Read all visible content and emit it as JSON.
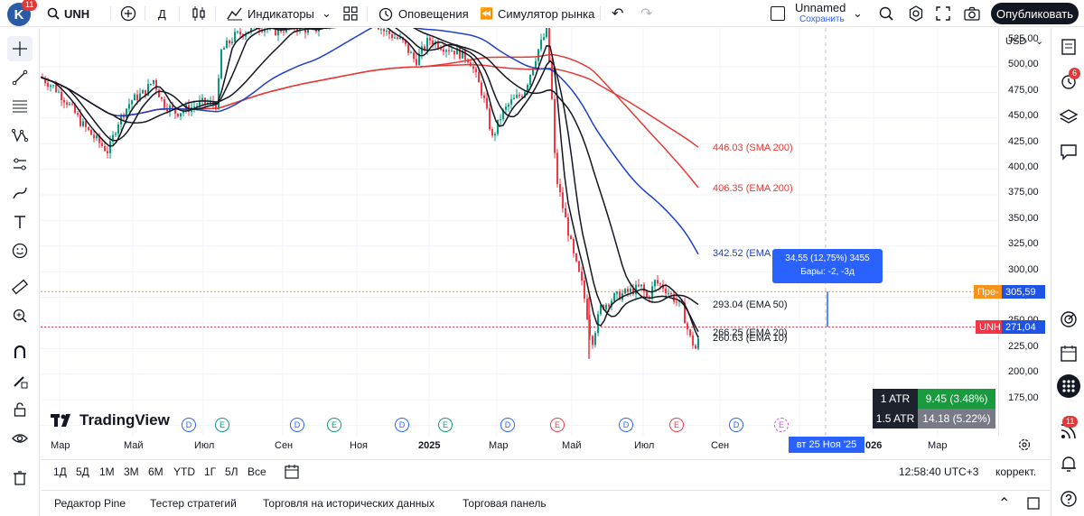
{
  "top": {
    "avatar_letter": "K",
    "avatar_badge": "11",
    "symbol": "UNH",
    "interval": "Д",
    "indicators_label": "Индикаторы",
    "alerts_label": "Оповещения",
    "replay_label": "Симулятор рынка",
    "layout_name": "Unnamed",
    "save_label": "Сохранить",
    "publish_label": "Опубликовать"
  },
  "price_scale": {
    "currency": "USD",
    "ticks": [
      "525,00",
      "500,00",
      "475,00",
      "450,00",
      "425,00",
      "400,00",
      "375,00",
      "350,00",
      "325,00",
      "300,00",
      "275,00",
      "250,00",
      "225,00",
      "200,00",
      "175,00"
    ],
    "pre_label": "Пре-",
    "pre_price": "305,59",
    "symbol_label": "UNH",
    "last_price": "271,04"
  },
  "time_axis": {
    "labels": [
      "Мар",
      "Май",
      "Июл",
      "Сен",
      "Ноя",
      "2025",
      "Мар",
      "Май",
      "Июл",
      "Сен",
      "026",
      "Мар"
    ],
    "crosshair_date": "вт 25 Ноя '25"
  },
  "chart_data": {
    "type": "line",
    "symbol": "UNH",
    "interval": "1D",
    "ylim": [
      160,
      560
    ],
    "series": [
      {
        "name": "SMA 200",
        "last": 446.03,
        "color": "#e53935"
      },
      {
        "name": "EMA 200",
        "last": 406.35,
        "color": "#e53935"
      },
      {
        "name": "EMA 100",
        "last": 342.52,
        "color": "#1e3fc8"
      },
      {
        "name": "EMA 50",
        "last": 293.04,
        "color": "#131722"
      },
      {
        "name": "EMA 20",
        "last": 266.25,
        "color": "#131722"
      },
      {
        "name": "EMA 10",
        "last": 260.63,
        "color": "#131722"
      }
    ],
    "last_close": 271.04,
    "premarket": 305.59
  },
  "overlays": {
    "sma200_label": "446.03 (SMA 200)",
    "ema200_label": "406.35 (EMA 200)",
    "ema100_label": "342.52 (EMA",
    "ema50_label": "293.04 (EMA 50)",
    "ema20_label": "266.25 (EMA 20)",
    "ema10_label": "260.63 (EMA 10)",
    "tooltip_line1": "34,55 (12,75%) 3455",
    "tooltip_line2": "Бары: -2, -3д",
    "atr1_label": "1 ATR",
    "atr1_value": "9.45 (3.48%)",
    "atr2_label": "1.5 ATR",
    "atr2_value": "14.18 (5.22%)",
    "brand": "TradingView",
    "events": [
      "D",
      "E",
      "D",
      "E",
      "D",
      "E",
      "D",
      "E",
      "D",
      "E",
      "D",
      "E"
    ]
  },
  "ranges": [
    "1Д",
    "5Д",
    "1М",
    "3М",
    "6М",
    "YTD",
    "1Г",
    "5Л",
    "Все"
  ],
  "clock": "12:58:40 UTC+3",
  "adjust_label": "коррект.",
  "panels": [
    "Редактор Pine",
    "Тестер стратегий",
    "Торговля на исторических данных",
    "Торговая панель"
  ],
  "right_badges": {
    "alerts": "6",
    "notifications": "11"
  },
  "colors": {
    "accent": "#2962ff",
    "up": "#089981",
    "down": "#f23645",
    "pre": "#f7931a",
    "last": "#f23645"
  }
}
